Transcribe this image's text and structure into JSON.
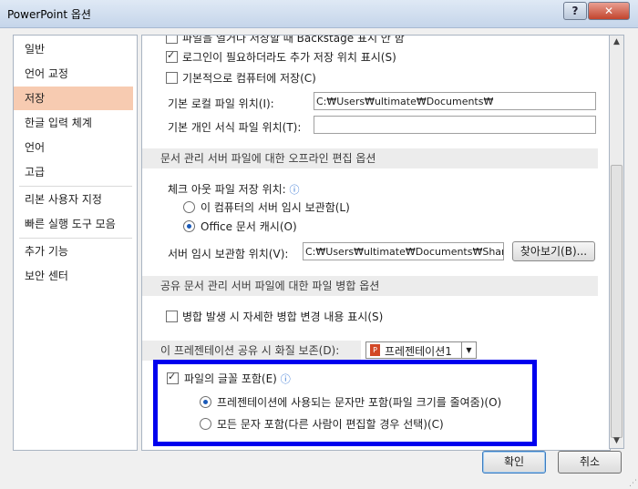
{
  "window": {
    "title": "PowerPoint 옵션",
    "help": "?",
    "close": "✕"
  },
  "sidebar": {
    "items": [
      "일반",
      "언어 교정",
      "저장",
      "한글 입력 체계",
      "언어",
      "고급",
      "리본 사용자 지정",
      "빠른 실행 도구 모음",
      "추가 기능",
      "보안 센터"
    ],
    "selected": "저장"
  },
  "content": {
    "top_partial": "파일을 열거나 저장할 때 Backstage 표시 안 함",
    "login_required": "로그인이 필요하더라도 추가 저장 위치 표시(S)",
    "save_to_computer": "기본적으로 컴퓨터에 저장(C)",
    "local_path_label": "기본 로컬 파일 위치(I):",
    "local_path_value": "C:₩Users₩ultimate₩Documents₩",
    "template_path_label": "기본 개인 서식 파일 위치(T):",
    "template_path_value": "",
    "offline_section": "문서 관리 서버 파일에 대한 오프라인 편집 옵션",
    "checkout_label": "체크 아웃 파일 저장 위치:",
    "info_glyph": "ⓘ",
    "radio_server_drafts": "이 컴퓨터의 서버 임시 보관함(L)",
    "radio_office_cache": "Office 문서 캐시(O)",
    "server_drafts_label": "서버 임시 보관함 위치(V):",
    "server_drafts_value": "C:₩Users₩ultimate₩Documents₩SharePoint",
    "browse_button": "찾아보기(B)...",
    "merge_section": "공유 문서 관리 서버 파일에 대한 파일 병합 옵션",
    "merge_detail": "병합 발생 시 자세한 병합 변경 내용 표시(S)",
    "fidelity_label": "이 프레젠테이션 공유 시 화질 보존(D):",
    "fidelity_select": "프레젠테이션1",
    "embed_fonts": "파일의 글꼴 포함(E)",
    "embed_used_only": "프레젠테이션에 사용되는 문자만 포함(파일 크기를 줄여줌)(O)",
    "embed_all": "모든 문자 포함(다른 사람이 편집할 경우 선택)(C)"
  },
  "footer": {
    "ok": "확인",
    "cancel": "취소"
  }
}
